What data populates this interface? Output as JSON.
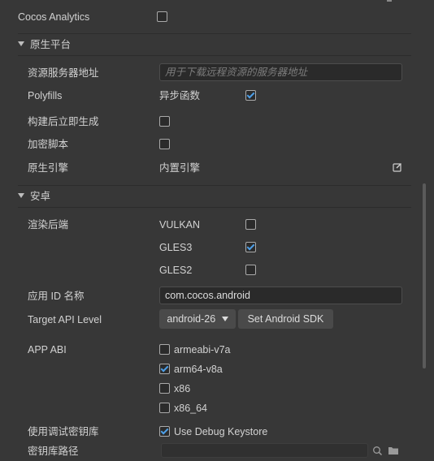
{
  "top": {
    "cocos_analytics_label": "Cocos Analytics"
  },
  "native": {
    "section_title": "原生平台",
    "resource_server_label": "资源服务器地址",
    "resource_server_placeholder": "用于下载远程资源的服务器地址",
    "polyfills_label": "Polyfills",
    "async_label": "异步函数",
    "build_immediately_label": "构建后立即生成",
    "encrypt_label": "加密脚本",
    "engine_label": "原生引擎",
    "engine_value": "内置引擎"
  },
  "android": {
    "section_title": "安卓",
    "render_backend_label": "渲染后端",
    "backends": [
      {
        "name": "VULKAN",
        "checked": false
      },
      {
        "name": "GLES3",
        "checked": true
      },
      {
        "name": "GLES2",
        "checked": false
      }
    ],
    "app_id_label": "应用 ID 名称",
    "app_id_value": "com.cocos.android",
    "target_api_label": "Target API Level",
    "target_api_value": "android-26",
    "set_sdk_button": "Set Android SDK",
    "app_abi_label": "APP ABI",
    "abis": [
      {
        "name": "armeabi-v7a",
        "checked": false
      },
      {
        "name": "arm64-v8a",
        "checked": true
      },
      {
        "name": "x86",
        "checked": false
      },
      {
        "name": "x86_64",
        "checked": false
      }
    ],
    "debug_keystore_label": "使用调试密钥库",
    "use_debug_keystore": "Use Debug Keystore",
    "keystore_path_label": "密钥库路径"
  }
}
